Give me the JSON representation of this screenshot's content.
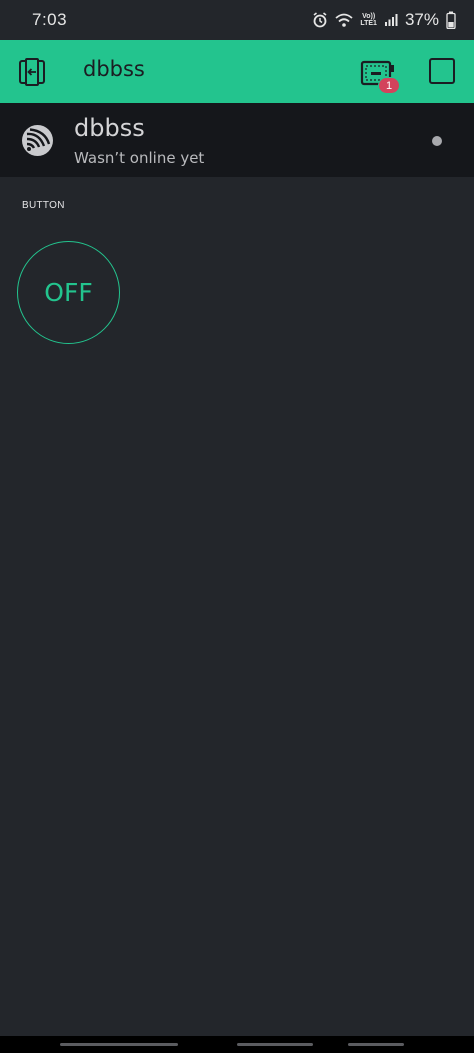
{
  "status_bar": {
    "time": "7:03",
    "lte_top": "Vo))",
    "lte_bottom": "LTE1",
    "battery": "37%"
  },
  "header": {
    "title": "dbbss",
    "notification_count": "1"
  },
  "device": {
    "name": "dbbss",
    "status": "Wasn’t online yet"
  },
  "widget": {
    "label": "BUTTON",
    "state_label": "OFF"
  },
  "colors": {
    "accent": "#23c48e",
    "background": "#23262b",
    "device_row": "#15171b",
    "badge": "#d3435c"
  }
}
